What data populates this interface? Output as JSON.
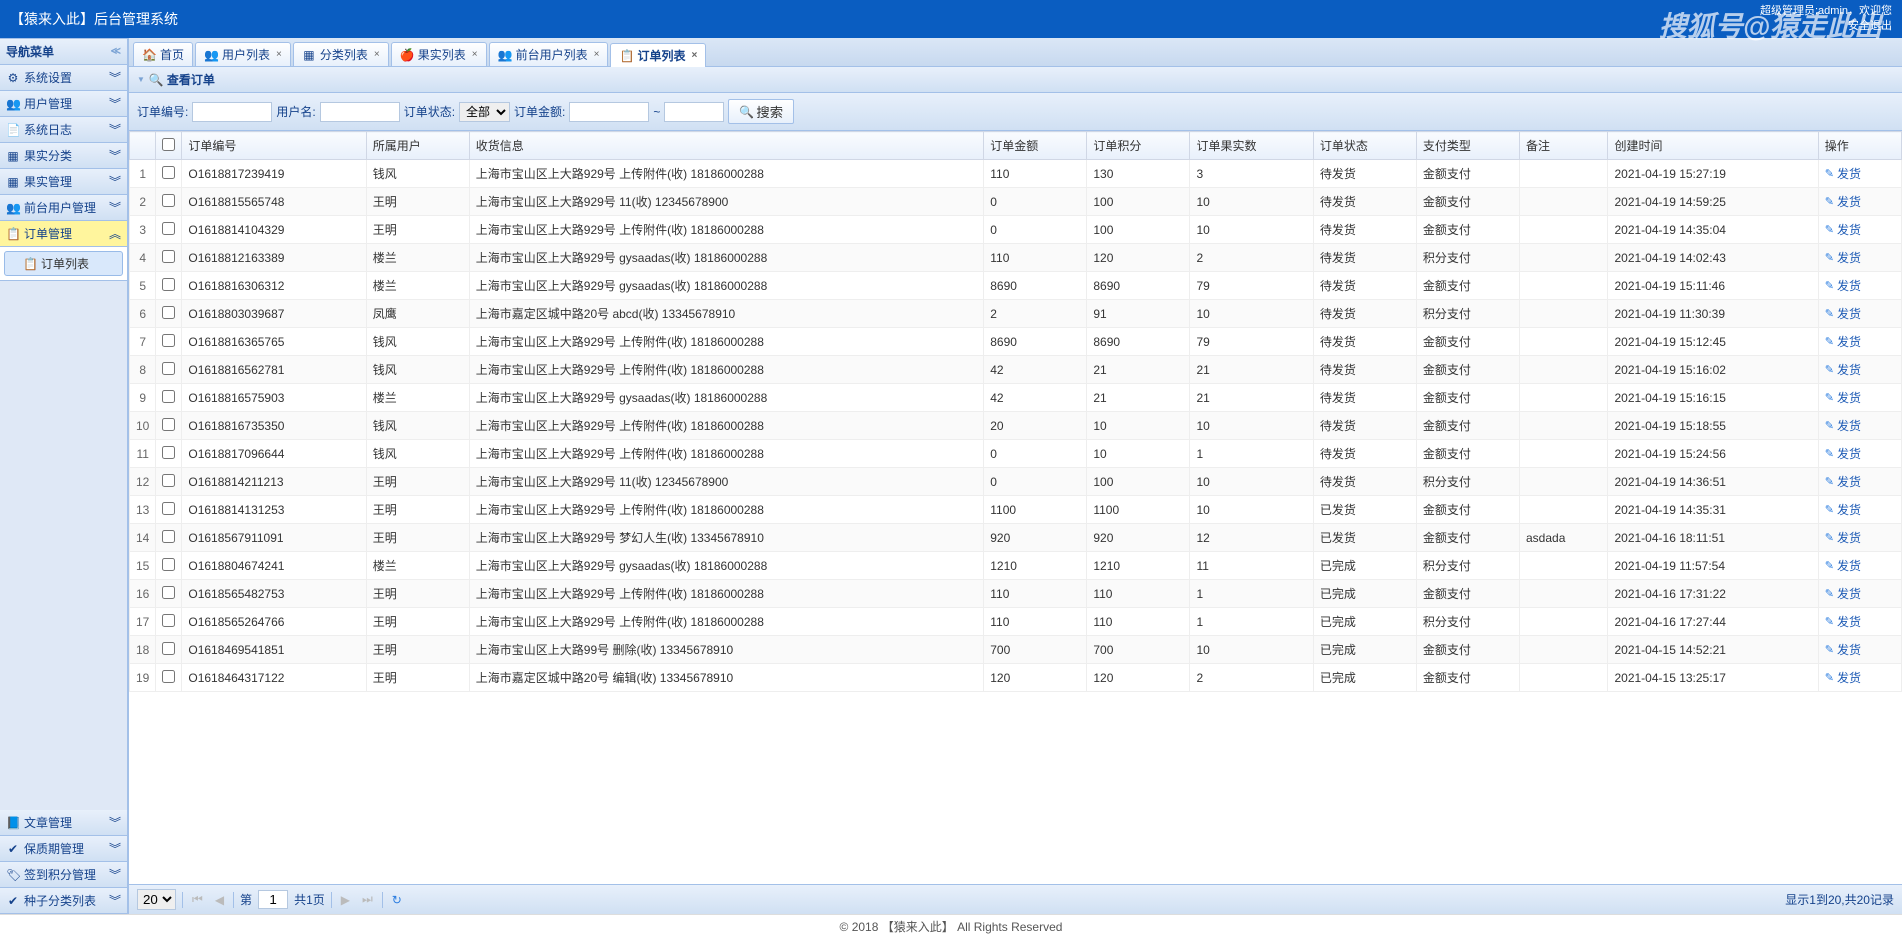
{
  "header": {
    "title": "【猿来入此】后台管理系统",
    "admin_label": "超级管理员:admin，欢迎您",
    "logout": "安全退出",
    "watermark": "搜狐号@猿走此出"
  },
  "sidebar": {
    "nav_title": "导航菜单",
    "items": [
      {
        "icon": "⚙",
        "label": "系统设置"
      },
      {
        "icon": "👥",
        "label": "用户管理"
      },
      {
        "icon": "📄",
        "label": "系统日志"
      },
      {
        "icon": "▦",
        "label": "果实分类"
      },
      {
        "icon": "▦",
        "label": "果实管理"
      },
      {
        "icon": "👥",
        "label": "前台用户管理"
      },
      {
        "icon": "📋",
        "label": "订单管理",
        "selected": true
      }
    ],
    "sub": [
      {
        "icon": "📋",
        "label": "订单列表",
        "selected": true
      }
    ],
    "bottom": [
      {
        "icon": "📘",
        "label": "文章管理"
      },
      {
        "icon": "✔",
        "label": "保质期管理"
      },
      {
        "icon": "🏷",
        "label": "签到积分管理"
      },
      {
        "icon": "✔",
        "label": "种子分类列表"
      }
    ]
  },
  "tabs": [
    {
      "icon": "🏠",
      "label": "首页",
      "closable": false
    },
    {
      "icon": "👥",
      "label": "用户列表",
      "closable": true
    },
    {
      "icon": "▦",
      "label": "分类列表",
      "closable": true
    },
    {
      "icon": "🍎",
      "label": "果实列表",
      "closable": true
    },
    {
      "icon": "👥",
      "label": "前台用户列表",
      "closable": true
    },
    {
      "icon": "📋",
      "label": "订单列表",
      "closable": true,
      "active": true
    }
  ],
  "panel": {
    "title": "查看订单"
  },
  "search": {
    "order_no_label": "订单编号:",
    "user_label": "用户名:",
    "status_label": "订单状态:",
    "status_options": [
      "全部"
    ],
    "status_value": "全部",
    "amount_label": "订单金额:",
    "tilde": "~",
    "search_btn": "搜索"
  },
  "table": {
    "columns": [
      "",
      "",
      "订单编号",
      "所属用户",
      "收货信息",
      "订单金额",
      "订单积分",
      "订单果实数",
      "订单状态",
      "支付类型",
      "备注",
      "创建时间",
      "操作"
    ],
    "op_label": "发货",
    "rows": [
      [
        "1",
        "O1618817239419",
        "钱风",
        "上海市宝山区上大路929号 上传附件(收) 18186000288",
        "110",
        "130",
        "3",
        "待发货",
        "金额支付",
        "",
        "2021-04-19 15:27:19"
      ],
      [
        "2",
        "O1618815565748",
        "王明",
        "上海市宝山区上大路929号 11(收) 12345678900",
        "0",
        "100",
        "10",
        "待发货",
        "金额支付",
        "",
        "2021-04-19 14:59:25"
      ],
      [
        "3",
        "O1618814104329",
        "王明",
        "上海市宝山区上大路929号 上传附件(收) 18186000288",
        "0",
        "100",
        "10",
        "待发货",
        "金额支付",
        "",
        "2021-04-19 14:35:04"
      ],
      [
        "4",
        "O1618812163389",
        "楼兰",
        "上海市宝山区上大路929号 gysaadas(收) 18186000288",
        "110",
        "120",
        "2",
        "待发货",
        "积分支付",
        "",
        "2021-04-19 14:02:43"
      ],
      [
        "5",
        "O1618816306312",
        "楼兰",
        "上海市宝山区上大路929号 gysaadas(收) 18186000288",
        "8690",
        "8690",
        "79",
        "待发货",
        "金额支付",
        "",
        "2021-04-19 15:11:46"
      ],
      [
        "6",
        "O1618803039687",
        "凤鹰",
        "上海市嘉定区城中路20号 abcd(收) 13345678910",
        "2",
        "91",
        "10",
        "待发货",
        "积分支付",
        "",
        "2021-04-19 11:30:39"
      ],
      [
        "7",
        "O1618816365765",
        "钱风",
        "上海市宝山区上大路929号 上传附件(收) 18186000288",
        "8690",
        "8690",
        "79",
        "待发货",
        "金额支付",
        "",
        "2021-04-19 15:12:45"
      ],
      [
        "8",
        "O1618816562781",
        "钱风",
        "上海市宝山区上大路929号 上传附件(收) 18186000288",
        "42",
        "21",
        "21",
        "待发货",
        "金额支付",
        "",
        "2021-04-19 15:16:02"
      ],
      [
        "9",
        "O1618816575903",
        "楼兰",
        "上海市宝山区上大路929号 gysaadas(收) 18186000288",
        "42",
        "21",
        "21",
        "待发货",
        "金额支付",
        "",
        "2021-04-19 15:16:15"
      ],
      [
        "10",
        "O1618816735350",
        "钱风",
        "上海市宝山区上大路929号 上传附件(收) 18186000288",
        "20",
        "10",
        "10",
        "待发货",
        "金额支付",
        "",
        "2021-04-19 15:18:55"
      ],
      [
        "11",
        "O1618817096644",
        "钱风",
        "上海市宝山区上大路929号 上传附件(收) 18186000288",
        "0",
        "10",
        "1",
        "待发货",
        "金额支付",
        "",
        "2021-04-19 15:24:56"
      ],
      [
        "12",
        "O1618814211213",
        "王明",
        "上海市宝山区上大路929号 11(收) 12345678900",
        "0",
        "100",
        "10",
        "待发货",
        "积分支付",
        "",
        "2021-04-19 14:36:51"
      ],
      [
        "13",
        "O1618814131253",
        "王明",
        "上海市宝山区上大路929号 上传附件(收) 18186000288",
        "1100",
        "1100",
        "10",
        "已发货",
        "金额支付",
        "",
        "2021-04-19 14:35:31"
      ],
      [
        "14",
        "O1618567911091",
        "王明",
        "上海市宝山区上大路929号 梦幻人生(收) 13345678910",
        "920",
        "920",
        "12",
        "已发货",
        "金额支付",
        "asdada",
        "2021-04-16 18:11:51"
      ],
      [
        "15",
        "O1618804674241",
        "楼兰",
        "上海市宝山区上大路929号 gysaadas(收) 18186000288",
        "1210",
        "1210",
        "11",
        "已完成",
        "积分支付",
        "",
        "2021-04-19 11:57:54"
      ],
      [
        "16",
        "O1618565482753",
        "王明",
        "上海市宝山区上大路929号 上传附件(收) 18186000288",
        "110",
        "110",
        "1",
        "已完成",
        "金额支付",
        "",
        "2021-04-16 17:31:22"
      ],
      [
        "17",
        "O1618565264766",
        "王明",
        "上海市宝山区上大路929号 上传附件(收) 18186000288",
        "110",
        "110",
        "1",
        "已完成",
        "积分支付",
        "",
        "2021-04-16 17:27:44"
      ],
      [
        "18",
        "O1618469541851",
        "王明",
        "上海市宝山区上大路99号 删除(收) 13345678910",
        "700",
        "700",
        "10",
        "已完成",
        "金额支付",
        "",
        "2021-04-15 14:52:21"
      ],
      [
        "19",
        "O1618464317122",
        "王明",
        "上海市嘉定区城中路20号 编辑(收) 13345678910",
        "120",
        "120",
        "2",
        "已完成",
        "金额支付",
        "",
        "2021-04-15 13:25:17"
      ]
    ]
  },
  "pager": {
    "page_size": "20",
    "page_label_pre": "第",
    "page": "1",
    "page_label_post": "共1页",
    "info": "显示1到20,共20记录"
  },
  "footer": "© 2018  【猿来入此】 All Rights Reserved"
}
